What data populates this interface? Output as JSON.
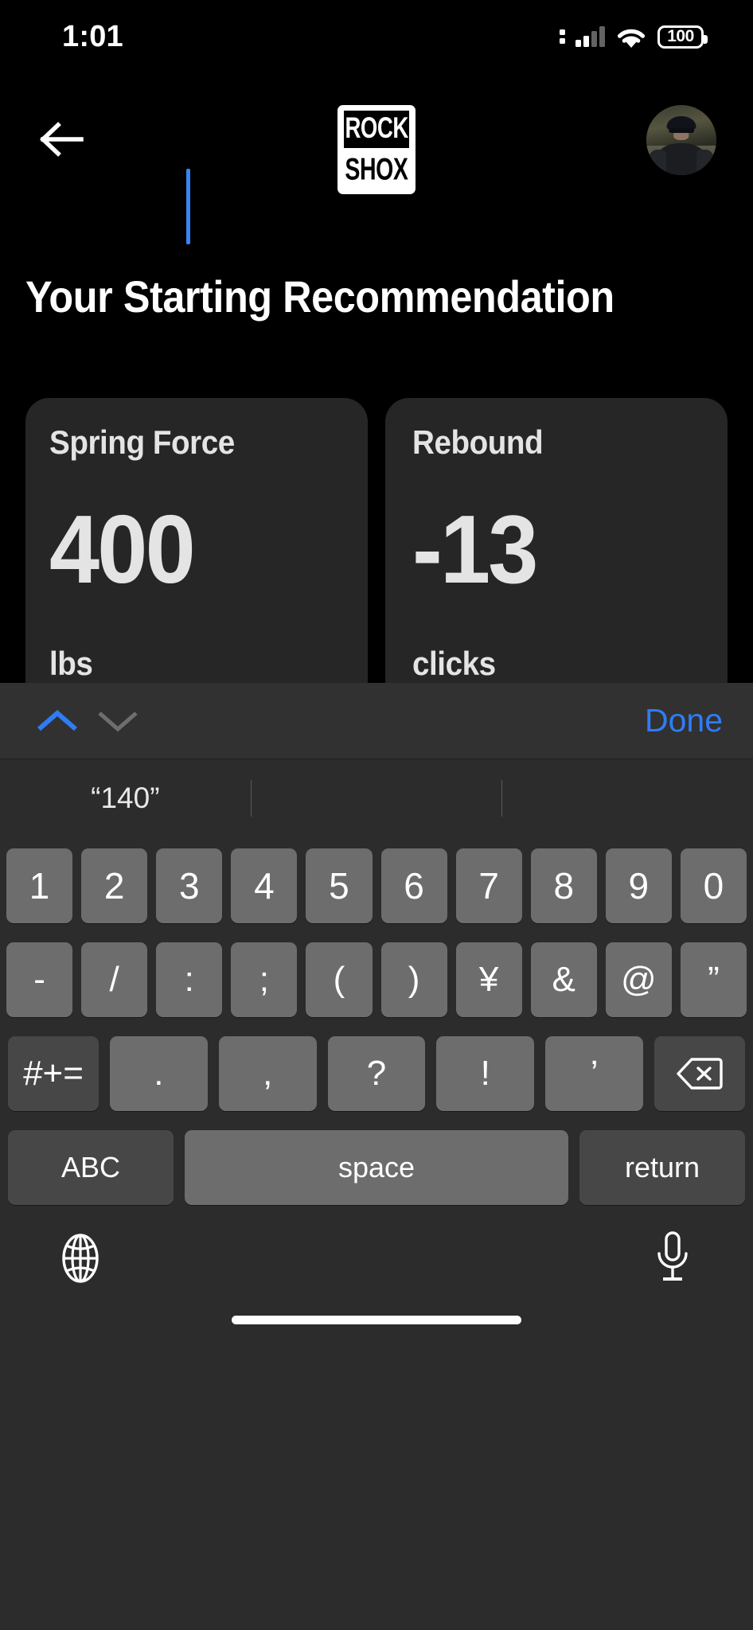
{
  "status_bar": {
    "time": "1:01",
    "battery_percent": "100",
    "cellular_icon": "signal-bars-icon",
    "wifi_icon": "wifi-icon",
    "battery_icon": "battery-icon"
  },
  "header": {
    "back_icon": "arrow-left-icon",
    "logo_top": "ROCK",
    "logo_bottom": "SHOX",
    "avatar_alt": "cyclist-profile-photo",
    "caret_color": "#3b82f6"
  },
  "main": {
    "page_title": "Your Starting Recommendation",
    "cards": [
      {
        "label": "Spring Force",
        "value": "400",
        "unit": "lbs"
      },
      {
        "label": "Rebound",
        "value": "-13",
        "unit": "clicks"
      }
    ],
    "card_bg": "#262626"
  },
  "keyboard": {
    "toolbar": {
      "prev_field_icon": "chevron-up-icon",
      "next_field_icon": "chevron-down-icon",
      "done_label": "Done",
      "done_color": "#2f7cf6",
      "prev_enabled_color": "#2f7cf6",
      "next_disabled_color": "#6e6e6e"
    },
    "predictions": [
      "“140”",
      "",
      ""
    ],
    "row_numbers": [
      "1",
      "2",
      "3",
      "4",
      "5",
      "6",
      "7",
      "8",
      "9",
      "0"
    ],
    "row_symbols": [
      "-",
      "/",
      ":",
      ";",
      "(",
      ")",
      "¥",
      "&",
      "@",
      "”"
    ],
    "row_third": {
      "shift_label": "#+=",
      "keys": [
        ".",
        ",",
        "?",
        "!",
        "’"
      ],
      "backspace_icon": "backspace-icon"
    },
    "row_bottom": {
      "abc_label": "ABC",
      "space_label": "space",
      "return_label": "return"
    },
    "bottom_bar": {
      "globe_icon": "globe-icon",
      "mic_icon": "microphone-icon",
      "home_indicator": "home-indicator"
    },
    "key_bg": "#6d6d6d",
    "key_bg_dark": "#474747",
    "keyboard_bg": "#2c2c2c"
  }
}
